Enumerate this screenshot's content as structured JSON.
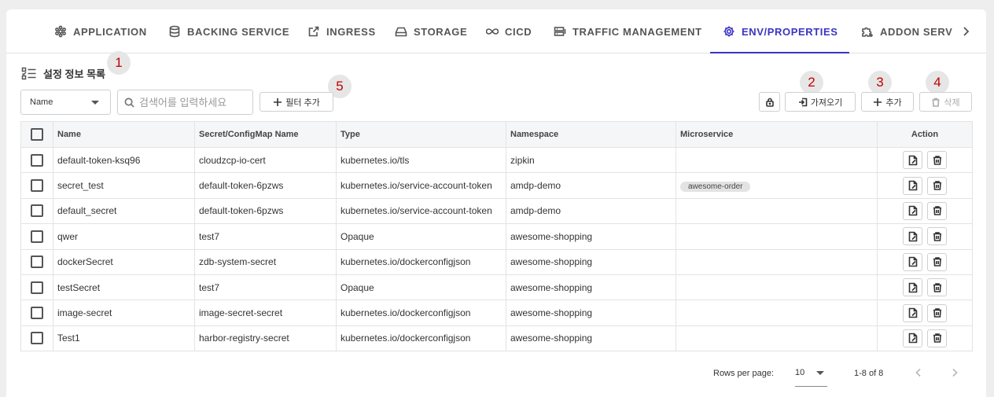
{
  "tabs": [
    {
      "label": "APPLICATION",
      "icon": "hexagon-cluster-icon"
    },
    {
      "label": "BACKING SERVICE",
      "icon": "database-icon"
    },
    {
      "label": "INGRESS",
      "icon": "external-link-icon"
    },
    {
      "label": "STORAGE",
      "icon": "hard-drive-icon"
    },
    {
      "label": "CICD",
      "icon": "infinity-icon"
    },
    {
      "label": "TRAFFIC MANAGEMENT",
      "icon": "server-traffic-icon"
    },
    {
      "label": "ENV/PROPERTIES",
      "icon": "gear-icon",
      "active": true
    },
    {
      "label": "ADDON SERV",
      "icon": "puzzle-add-icon"
    }
  ],
  "page": {
    "title": "설정 정보 목록"
  },
  "markers": [
    "1",
    "2",
    "3",
    "4",
    "5"
  ],
  "filter": {
    "field_selected": "Name",
    "search_placeholder": "검색어를 입력하세요",
    "add_filter_label": "필터 추가"
  },
  "toolbar": {
    "import_label": "가져오기",
    "add_label": "추가",
    "delete_label": "삭제"
  },
  "table": {
    "columns": [
      "Name",
      "Secret/ConfigMap Name",
      "Type",
      "Namespace",
      "Microservice",
      "Action"
    ],
    "rows": [
      {
        "name": "default-token-ksq96",
        "secret": "cloudzcp-io-cert",
        "type": "kubernetes.io/tls",
        "namespace": "zipkin",
        "microservice": ""
      },
      {
        "name": "secret_test",
        "secret": "default-token-6pzws",
        "type": "kubernetes.io/service-account-token",
        "namespace": "amdp-demo",
        "microservice": "awesome-order"
      },
      {
        "name": "default_secret",
        "secret": "default-token-6pzws",
        "type": "kubernetes.io/service-account-token",
        "namespace": "amdp-demo",
        "microservice": ""
      },
      {
        "name": "qwer",
        "secret": "test7",
        "type": "Opaque",
        "namespace": "awesome-shopping",
        "microservice": ""
      },
      {
        "name": "dockerSecret",
        "secret": "zdb-system-secret",
        "type": "kubernetes.io/dockerconfigjson",
        "namespace": "awesome-shopping",
        "microservice": ""
      },
      {
        "name": "testSecret",
        "secret": "test7",
        "type": "Opaque",
        "namespace": "awesome-shopping",
        "microservice": ""
      },
      {
        "name": "image-secret",
        "secret": "image-secret-secret",
        "type": "kubernetes.io/dockerconfigjson",
        "namespace": "awesome-shopping",
        "microservice": ""
      },
      {
        "name": "Test1",
        "secret": "harbor-registry-secret",
        "type": "kubernetes.io/dockerconfigjson",
        "namespace": "awesome-shopping",
        "microservice": ""
      }
    ]
  },
  "pagination": {
    "rows_per_page_label": "Rows per page:",
    "rows_per_page": "10",
    "range": "1-8 of 8"
  },
  "colors": {
    "accent": "#3b33c4",
    "marker_text": "#c00000"
  }
}
